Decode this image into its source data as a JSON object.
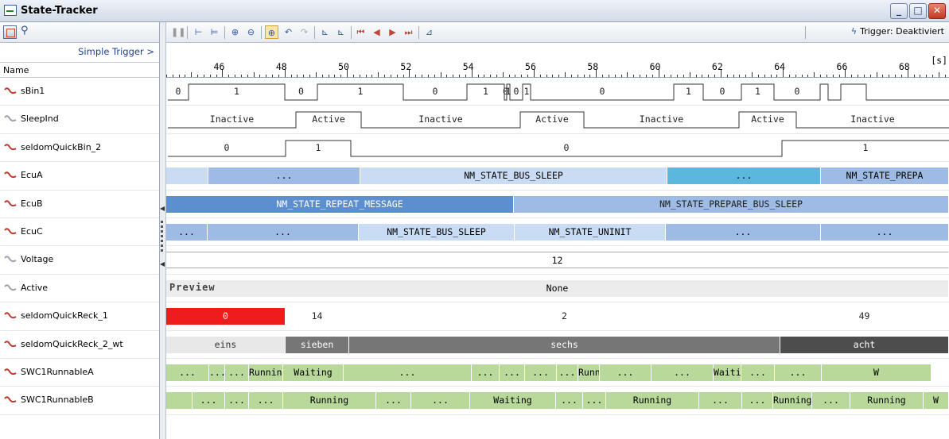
{
  "window": {
    "title": "State-Tracker",
    "min": "_",
    "max": "□",
    "close": "✕"
  },
  "left": {
    "simple_trigger": "Simple Trigger >",
    "name_header": "Name",
    "signals": [
      {
        "name": "sBin1",
        "icon": "signal-bin-icon"
      },
      {
        "name": "SleepInd",
        "icon": "signal-analog-icon"
      },
      {
        "name": "seldomQuickBin_2",
        "icon": "signal-bin-icon"
      },
      {
        "name": "EcuA",
        "icon": "signal-bin-icon"
      },
      {
        "name": "EcuB",
        "icon": "signal-bin-icon"
      },
      {
        "name": "EcuC",
        "icon": "signal-bin-icon"
      },
      {
        "name": "Voltage",
        "icon": "signal-analog-icon"
      },
      {
        "name": "Active",
        "icon": "signal-analog-icon"
      },
      {
        "name": "seldomQuickReck_1",
        "icon": "signal-bin-icon"
      },
      {
        "name": "seldomQuickReck_2_wt",
        "icon": "signal-bin-icon"
      },
      {
        "name": "SWC1RunnableA",
        "icon": "signal-bin-icon"
      },
      {
        "name": "SWC1RunnableB",
        "icon": "signal-bin-icon"
      }
    ]
  },
  "toolbar": {
    "trigger_label": "Trigger: Deaktiviert"
  },
  "ruler": {
    "unit": "[s]",
    "labels": [
      "46",
      "48",
      "50",
      "52",
      "54",
      "56",
      "58",
      "60",
      "62",
      "64",
      "66",
      "68"
    ]
  },
  "tracks": {
    "sBin1": {
      "values": [
        "0",
        "1",
        "0",
        "1",
        "0",
        "1",
        "0",
        "1",
        "0",
        "1",
        "0",
        "1",
        "0",
        "1",
        "0"
      ]
    },
    "SleepInd": {
      "values": [
        "Inactive",
        "Active",
        "Inactive",
        "Active",
        "Inactive",
        "Active",
        "Inactive"
      ]
    },
    "seldomQuickBin_2": {
      "values": [
        "0",
        "1",
        "0",
        "1"
      ]
    },
    "EcuA": {
      "values": [
        "",
        "...",
        "NM_STATE_BUS_SLEEP",
        "...",
        "NM_STATE_PREPA"
      ]
    },
    "EcuB": {
      "values": [
        "NM_STATE_REPEAT_MESSAGE",
        "NM_STATE_PREPARE_BUS_SLEEP"
      ]
    },
    "EcuC": {
      "values": [
        "...",
        "...",
        "NM_STATE_BUS_SLEEP",
        "NM_STATE_UNINIT",
        "...",
        "..."
      ]
    },
    "Voltage": {
      "value": "12"
    },
    "Active": {
      "preview": "Preview",
      "value": "None"
    },
    "seldomQuickReck_1": {
      "values": [
        "0",
        "14",
        "2",
        "49"
      ]
    },
    "seldomQuickReck_2_wt": {
      "values": [
        "eins",
        "sieben",
        "sechs",
        "acht"
      ]
    },
    "SWC1RunnableA": {
      "values": [
        "...",
        "...",
        "...",
        "Running",
        "Waiting",
        "...",
        "...",
        "...",
        "...",
        "...",
        "Running",
        "...",
        "...",
        "Waiting",
        "...",
        "...",
        "W"
      ]
    },
    "SWC1RunnableB": {
      "values": [
        "",
        "...",
        "...",
        "...",
        "Running",
        "...",
        "...",
        "Waiting",
        "...",
        "...",
        "Running",
        "...",
        "...",
        "Running",
        "...",
        "Running",
        "W"
      ]
    }
  },
  "colors": {
    "red": "#ee1c1c",
    "blue_dark": "#5b8fd0",
    "blue_mid": "#9dbbe5",
    "blue_light": "#c9dcf3",
    "teal": "#5ab8de",
    "green": "#b8d99a",
    "gray_dark": "#767676",
    "gray_darker": "#4d4d4d"
  }
}
